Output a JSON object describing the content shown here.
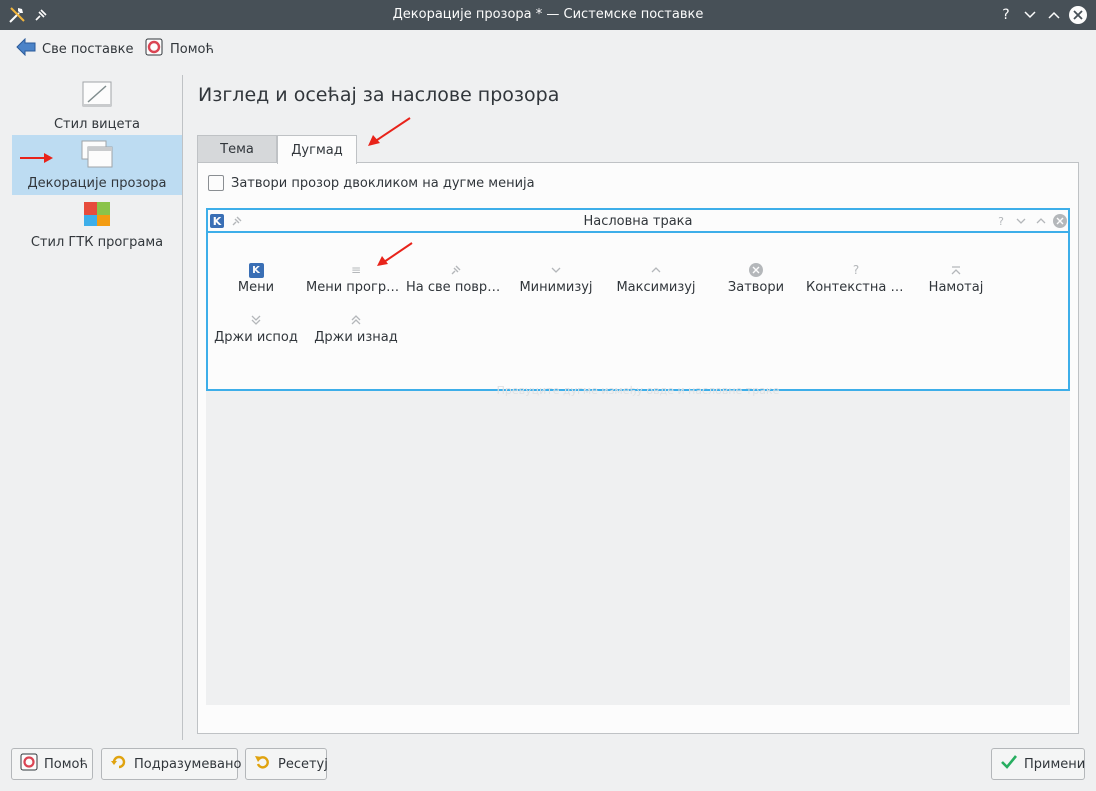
{
  "window": {
    "title": "Декорације прозора * — Системске поставке",
    "controls": [
      "help-icon",
      "minimize-icon",
      "maximize-icon",
      "close-icon"
    ]
  },
  "toolbar": {
    "all_settings": "Све поставке",
    "help": "Помоћ"
  },
  "sidebar": {
    "items": [
      {
        "label": "Стил вицета",
        "icon": "widget-style-icon",
        "active": false
      },
      {
        "label": "Декорације прозора",
        "icon": "window-decorations-icon",
        "active": true
      },
      {
        "label": "Стил ГТК програма",
        "icon": "gtk-style-icon",
        "active": false
      }
    ]
  },
  "main": {
    "title": "Изглед и осећај за наслове прозора",
    "tabs": [
      {
        "label": "Тема",
        "active": false
      },
      {
        "label": "Дугмад",
        "active": true
      }
    ],
    "checkbox_label": "Затвори прозор двокликом на дугме менија",
    "preview": {
      "title": "Насловна трака",
      "drop_hint": "Превуците дугме између овде и насловне траке"
    },
    "buttons": [
      {
        "label": "Мени",
        "icon": "kde-menu-icon"
      },
      {
        "label": "Мени програ…",
        "icon": "hamburger-icon"
      },
      {
        "label": "На све површи",
        "icon": "pin-icon"
      },
      {
        "label": "Минимизуј",
        "icon": "chevron-down-icon"
      },
      {
        "label": "Максимизуј",
        "icon": "chevron-up-icon"
      },
      {
        "label": "Затвори",
        "icon": "close-circle-icon"
      },
      {
        "label": "Контекстна п…",
        "icon": "question-icon"
      },
      {
        "label": "Намотај",
        "icon": "shade-icon"
      },
      {
        "label": "Држи испод",
        "icon": "keep-below-icon"
      },
      {
        "label": "Држи изнад",
        "icon": "keep-above-icon"
      }
    ]
  },
  "footer": {
    "help": "Помоћ",
    "defaults": "Подразумевано",
    "reset": "Ресетуј",
    "apply": "Примени"
  },
  "colors": {
    "accent": "#3daee9",
    "selection": "#bddcf2",
    "titlebar": "#475057",
    "annotation_arrow": "#e8231a"
  }
}
